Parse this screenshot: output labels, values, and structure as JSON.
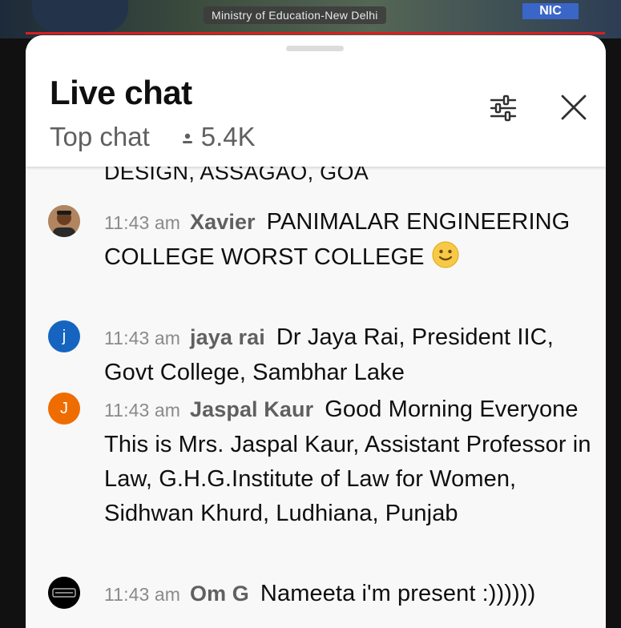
{
  "video": {
    "banner_text": "Ministry of Education-New Delhi",
    "logo_text": "NIC"
  },
  "header": {
    "title": "Live chat",
    "mode": "Top chat",
    "viewer_count": "5.4K"
  },
  "cut_message_tail": "DESIGN, ASSAGAO, GOA",
  "messages": [
    {
      "time": "11:43 am",
      "author": "Xavier",
      "text": "PANIMALAR ENGINEERING COLLEGE WORST COLLEGE",
      "emoji": "slightly-smiling-face",
      "avatar_type": "photo"
    },
    {
      "time": "11:43 am",
      "author": "jaya rai",
      "text": "Dr Jaya Rai, President IIC, Govt College, Sambhar Lake",
      "avatar_letter": "j",
      "avatar_color": "#1565c0"
    },
    {
      "time": "11:43 am",
      "author": "Jaspal Kaur",
      "text": "Good Morning Everyone This is Mrs. Jaspal Kaur, Assistant Professor in Law, G.H.G.Institute of Law for Women, Sidhwan Khurd, Ludhiana, Punjab",
      "avatar_letter": "J",
      "avatar_color": "#ef6c00"
    },
    {
      "time": "11:43 am",
      "author": "Om G",
      "text": "Nameeta i'm present :))))))",
      "avatar_type": "logo",
      "avatar_color": "#000000"
    }
  ],
  "colors": {
    "panel_bg": "#f8f8f8",
    "header_bg": "#ffffff",
    "timestamp": "#8a8a8a",
    "author": "#606060"
  }
}
